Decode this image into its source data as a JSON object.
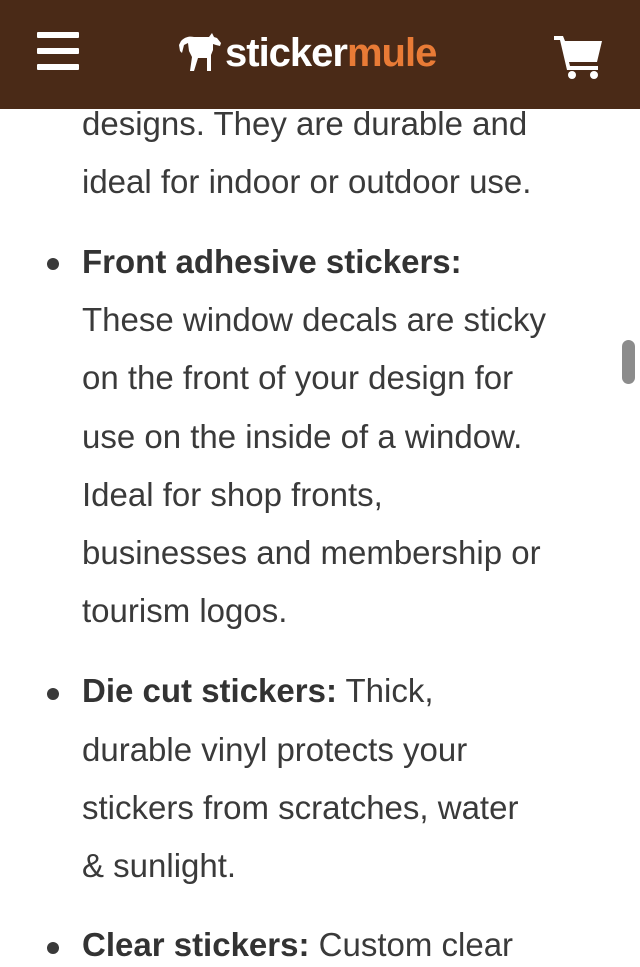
{
  "header": {
    "logo_text_1": "sticker",
    "logo_text_2": "mule",
    "bg_color": "#4a2a17",
    "accent_color": "#e97b36",
    "menu_icon": "hamburger-menu-icon",
    "cart_icon": "shopping-cart-icon"
  },
  "content": {
    "intro_lines": [
      "designs. They are durable and",
      "ideal for indoor or outdoor use."
    ],
    "items": [
      {
        "title": "Front adhesive stickers:",
        "lines": [
          "These window decals are sticky",
          "on the front of your design for",
          "use on the inside of a window.",
          "Ideal for shop fronts,",
          "businesses and membership or",
          "tourism logos."
        ]
      },
      {
        "title": "Die cut stickers:",
        "title_suffix": " Thick,",
        "lines": [
          "durable vinyl protects your",
          "stickers from scratches, water",
          "& sunlight."
        ]
      },
      {
        "title": "Clear stickers:",
        "title_suffix": " Custom clear"
      }
    ]
  }
}
